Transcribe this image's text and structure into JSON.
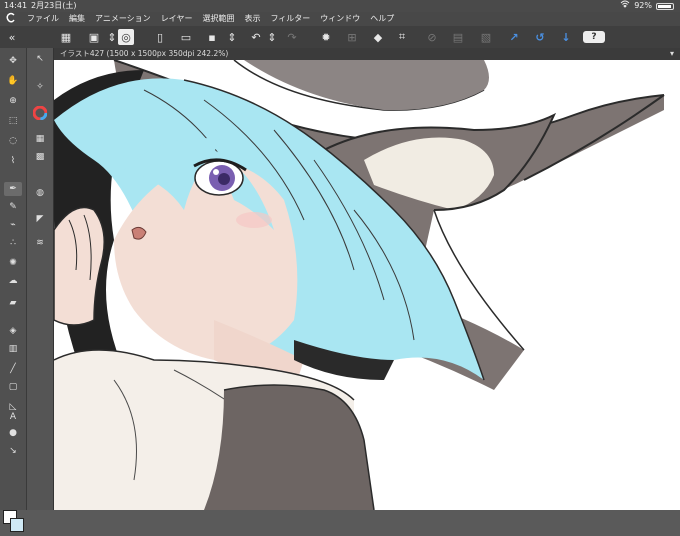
{
  "status_bar": {
    "time": "14:41",
    "date": "2月23日(土)",
    "battery": "92%",
    "battery_level": 0.92
  },
  "menu": {
    "items": [
      "ファイル",
      "編集",
      "アニメーション",
      "レイヤー",
      "選択範囲",
      "表示",
      "フィルター",
      "ウィンドウ",
      "ヘルプ"
    ]
  },
  "command_bar": {
    "help_label": "?"
  },
  "canvas_tab": {
    "title": "イラスト427 (1500 x 1500px 350dpi 242.2%)"
  },
  "colors": {
    "hair": "#a9e6f2",
    "hair_line": "#2b2b2b",
    "hat": "#7d7472",
    "skin": "#f3ded5",
    "eye": "#7a5fb1",
    "shirt": "#f4efe9",
    "vest": "#6d6563",
    "ear_inner": "#f1ece3",
    "ui_dark": "#3f3f3f",
    "main_color": "#ffffff",
    "sub_color": "#cfe9f5"
  },
  "tools": [
    "move-icon",
    "hand-icon",
    "zoom-icon",
    "select-icon",
    "lasso-icon",
    "eyedropper-icon",
    "pen-icon",
    "pencil-icon",
    "brush-icon",
    "airbrush-icon",
    "blend-icon",
    "eraser-icon",
    "fill-icon",
    "gradient-icon",
    "figure-icon",
    "frame-icon",
    "ruler-icon",
    "text-icon",
    "balloon-icon",
    "line-correction-icon"
  ]
}
